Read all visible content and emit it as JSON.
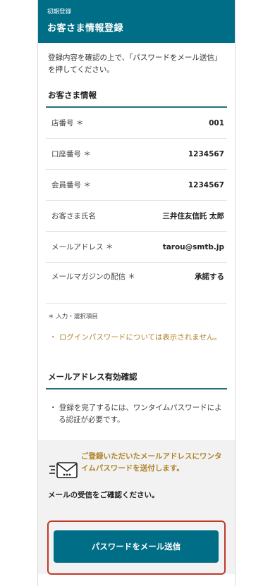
{
  "header": {
    "subtitle": "初期登録",
    "title": "お客さま情報登録"
  },
  "intro": "登録内容を確認の上で、「パスワードをメール送信」を押してください。",
  "customer_section": {
    "title": "お客さま情報",
    "rows": [
      {
        "label": "店番号 ＊",
        "value": "001"
      },
      {
        "label": "口座番号 ＊",
        "value": "1234567"
      },
      {
        "label": "会員番号 ＊",
        "value": "1234567"
      },
      {
        "label": "お客さま氏名",
        "value": "三井住友信託 太郎"
      },
      {
        "label": "メールアドレス ＊",
        "value": "tarou@smtb.jp"
      },
      {
        "label": "メールマガジンの配信 ＊",
        "value": "承諾する"
      }
    ],
    "required_note": "＊ 入力・選択項目",
    "password_note": "・ ログインパスワードについては表示されません。"
  },
  "email_section": {
    "title": "メールアドレス有効確認",
    "info": "・ 登録を完了するには、ワンタイムパスワードによる認証が必要です。",
    "otp_message": "ご登録いただいたメールアドレスにワンタイムパスワードを送付します。",
    "confirm_message": "メールの受信をご確認ください。",
    "icon": "mail-icon"
  },
  "submit_label": "パスワードをメール送信",
  "colors": {
    "primary": "#006e86",
    "accent_gold": "#b0822a",
    "highlight": "#c0392b"
  }
}
